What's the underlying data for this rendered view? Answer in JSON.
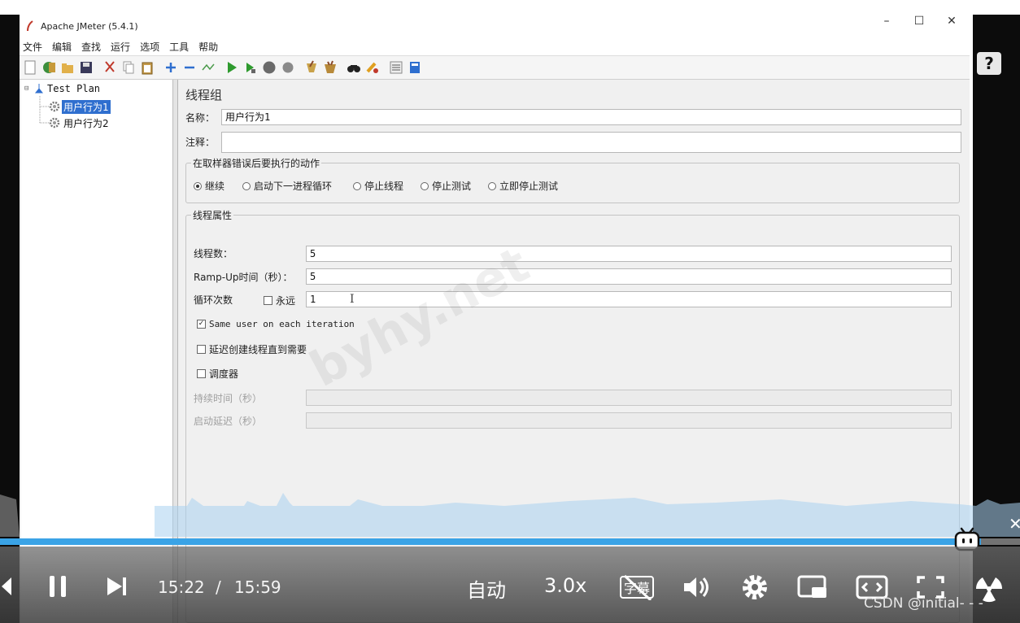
{
  "window": {
    "title": "Apache JMeter (5.4.1)",
    "controls": [
      "–",
      "☐",
      "✕"
    ]
  },
  "menu": [
    "文件",
    "编辑",
    "查找",
    "运行",
    "选项",
    "工具",
    "帮助"
  ],
  "toolbar_icons": [
    "new-icon",
    "templates-icon",
    "open-icon",
    "save-icon",
    "cut-icon",
    "copy-icon",
    "paste-icon",
    "expand-icon",
    "collapse-icon",
    "toggle-icon",
    "start-icon",
    "start-no-pause-icon",
    "stop-icon",
    "shutdown-icon",
    "clear-icon",
    "clear-all-icon",
    "search-icon",
    "reset-search-icon",
    "function-helper-icon",
    "help-icon"
  ],
  "tree": {
    "root": "Test Plan",
    "children": [
      "用户行为1",
      "用户行为2"
    ],
    "selected": "用户行为1"
  },
  "panel": {
    "title": "线程组",
    "name_label": "名称：",
    "name_value": "用户行为1",
    "comment_label": "注释：",
    "comment_value": "",
    "error_group_title": "在取样器错误后要执行的动作",
    "error_options": [
      "继续",
      "启动下一进程循环",
      "停止线程",
      "停止测试",
      "立即停止测试"
    ],
    "error_selected": "继续",
    "thread_group_title": "线程属性",
    "threads_label": "线程数：",
    "threads_value": "5",
    "rampup_label": "Ramp-Up时间（秒）：",
    "rampup_value": "5",
    "loop_label": "循环次数",
    "forever_label": "永远",
    "forever_checked": false,
    "loop_value": "1",
    "same_user_label": "Same user on each iteration",
    "same_user_checked": true,
    "delay_label": "延迟创建线程直到需要",
    "delay_checked": false,
    "scheduler_label": "调度器",
    "scheduler_checked": false,
    "duration_label": "持续时间（秒）",
    "duration_value": "",
    "startup_delay_label": "启动延迟（秒）",
    "startup_delay_value": ""
  },
  "watermark": "byhy.net",
  "player": {
    "current_time": "15:22",
    "separator": "/",
    "total_time": "15:59",
    "progress": 0.962,
    "quality": "自动",
    "speed": "3.0x",
    "subtitle_label": "字幕",
    "accent_color": "#3aa3e6"
  },
  "credit": "CSDN @initial- - -"
}
